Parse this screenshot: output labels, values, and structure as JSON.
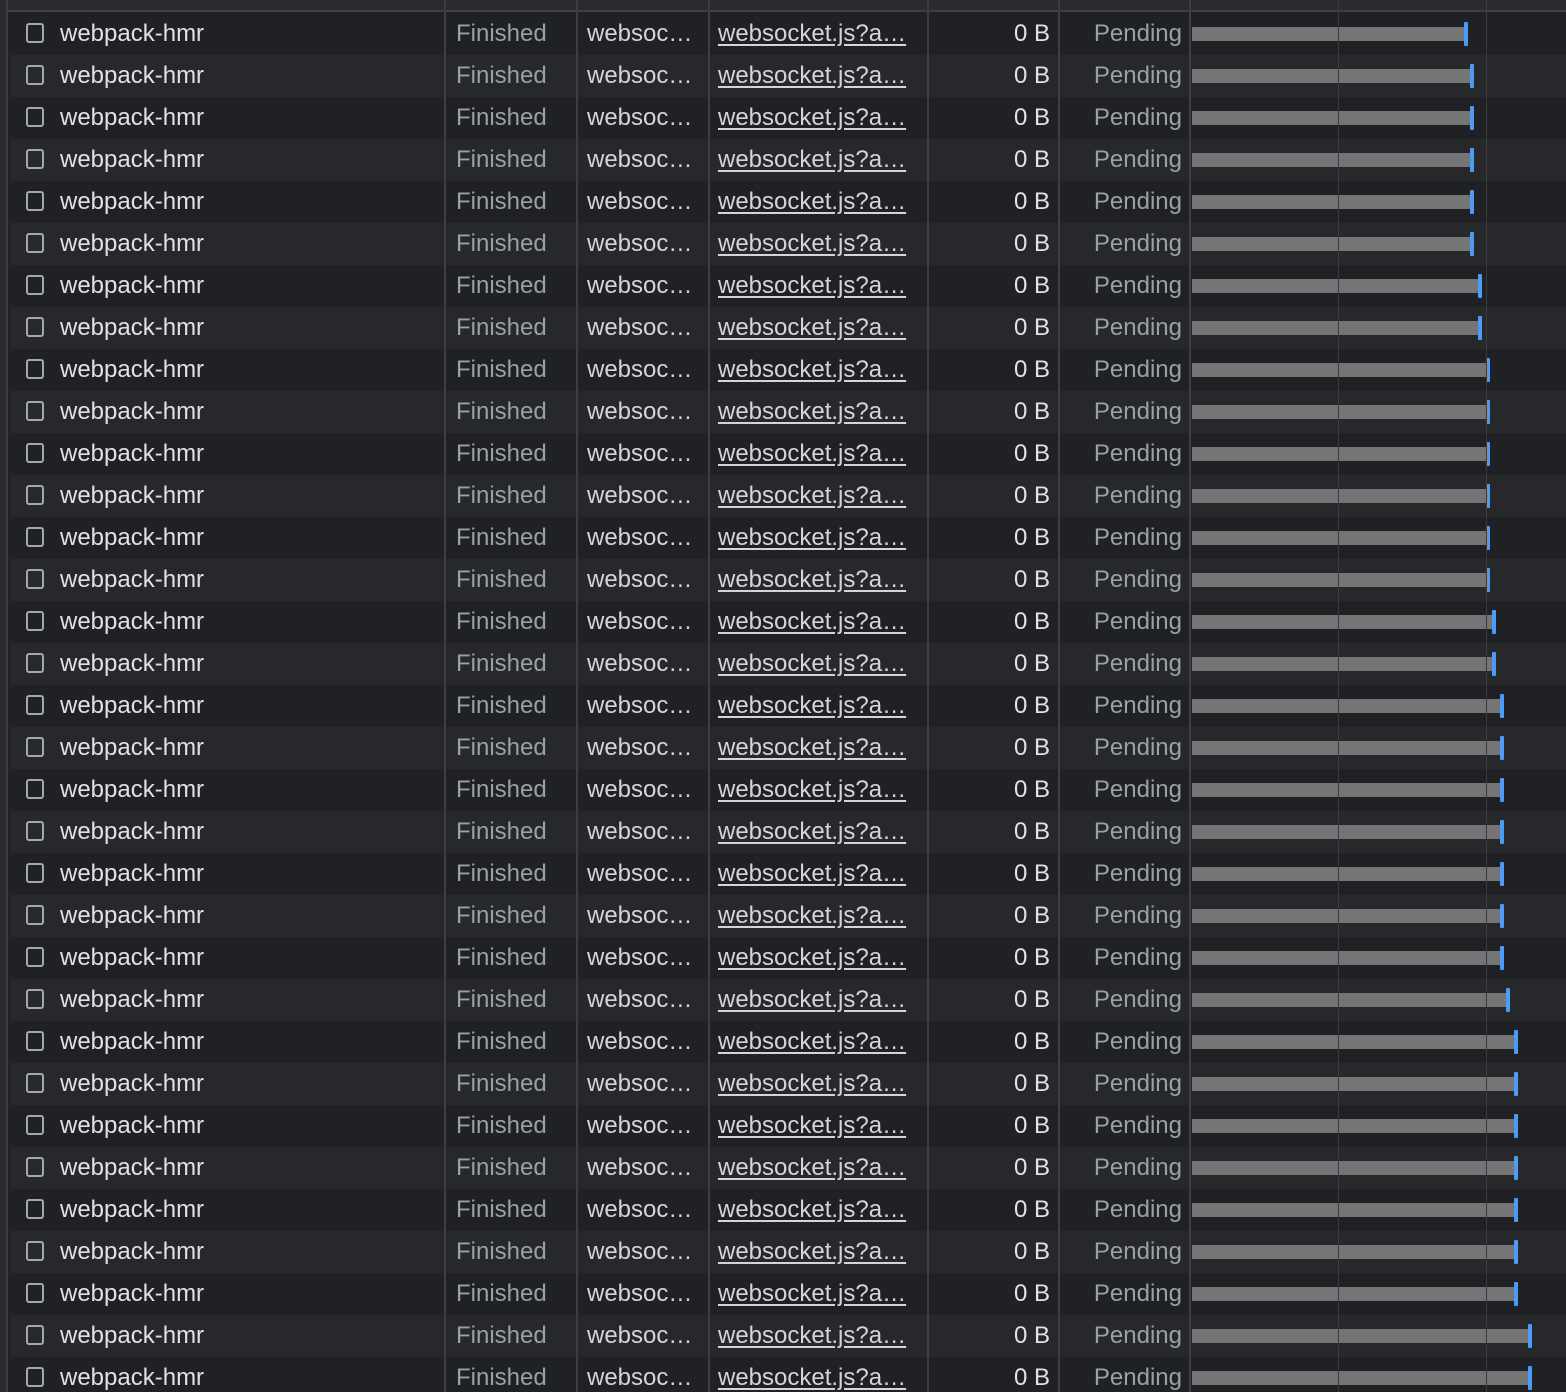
{
  "network_table": {
    "rows": [
      {
        "name": "webpack-hmr",
        "status": "Finished",
        "type": "websoc…",
        "initiator": "websocket.js?a…",
        "size": "0 B",
        "time": "Pending"
      },
      {
        "name": "webpack-hmr",
        "status": "Finished",
        "type": "websoc…",
        "initiator": "websocket.js?a…",
        "size": "0 B",
        "time": "Pending"
      },
      {
        "name": "webpack-hmr",
        "status": "Finished",
        "type": "websoc…",
        "initiator": "websocket.js?a…",
        "size": "0 B",
        "time": "Pending"
      },
      {
        "name": "webpack-hmr",
        "status": "Finished",
        "type": "websoc…",
        "initiator": "websocket.js?a…",
        "size": "0 B",
        "time": "Pending"
      },
      {
        "name": "webpack-hmr",
        "status": "Finished",
        "type": "websoc…",
        "initiator": "websocket.js?a…",
        "size": "0 B",
        "time": "Pending"
      },
      {
        "name": "webpack-hmr",
        "status": "Finished",
        "type": "websoc…",
        "initiator": "websocket.js?a…",
        "size": "0 B",
        "time": "Pending"
      },
      {
        "name": "webpack-hmr",
        "status": "Finished",
        "type": "websoc…",
        "initiator": "websocket.js?a…",
        "size": "0 B",
        "time": "Pending"
      },
      {
        "name": "webpack-hmr",
        "status": "Finished",
        "type": "websoc…",
        "initiator": "websocket.js?a…",
        "size": "0 B",
        "time": "Pending"
      },
      {
        "name": "webpack-hmr",
        "status": "Finished",
        "type": "websoc…",
        "initiator": "websocket.js?a…",
        "size": "0 B",
        "time": "Pending"
      },
      {
        "name": "webpack-hmr",
        "status": "Finished",
        "type": "websoc…",
        "initiator": "websocket.js?a…",
        "size": "0 B",
        "time": "Pending"
      },
      {
        "name": "webpack-hmr",
        "status": "Finished",
        "type": "websoc…",
        "initiator": "websocket.js?a…",
        "size": "0 B",
        "time": "Pending"
      },
      {
        "name": "webpack-hmr",
        "status": "Finished",
        "type": "websoc…",
        "initiator": "websocket.js?a…",
        "size": "0 B",
        "time": "Pending"
      },
      {
        "name": "webpack-hmr",
        "status": "Finished",
        "type": "websoc…",
        "initiator": "websocket.js?a…",
        "size": "0 B",
        "time": "Pending"
      },
      {
        "name": "webpack-hmr",
        "status": "Finished",
        "type": "websoc…",
        "initiator": "websocket.js?a…",
        "size": "0 B",
        "time": "Pending"
      },
      {
        "name": "webpack-hmr",
        "status": "Finished",
        "type": "websoc…",
        "initiator": "websocket.js?a…",
        "size": "0 B",
        "time": "Pending"
      },
      {
        "name": "webpack-hmr",
        "status": "Finished",
        "type": "websoc…",
        "initiator": "websocket.js?a…",
        "size": "0 B",
        "time": "Pending"
      },
      {
        "name": "webpack-hmr",
        "status": "Finished",
        "type": "websoc…",
        "initiator": "websocket.js?a…",
        "size": "0 B",
        "time": "Pending"
      },
      {
        "name": "webpack-hmr",
        "status": "Finished",
        "type": "websoc…",
        "initiator": "websocket.js?a…",
        "size": "0 B",
        "time": "Pending"
      },
      {
        "name": "webpack-hmr",
        "status": "Finished",
        "type": "websoc…",
        "initiator": "websocket.js?a…",
        "size": "0 B",
        "time": "Pending"
      },
      {
        "name": "webpack-hmr",
        "status": "Finished",
        "type": "websoc…",
        "initiator": "websocket.js?a…",
        "size": "0 B",
        "time": "Pending"
      },
      {
        "name": "webpack-hmr",
        "status": "Finished",
        "type": "websoc…",
        "initiator": "websocket.js?a…",
        "size": "0 B",
        "time": "Pending"
      },
      {
        "name": "webpack-hmr",
        "status": "Finished",
        "type": "websoc…",
        "initiator": "websocket.js?a…",
        "size": "0 B",
        "time": "Pending"
      },
      {
        "name": "webpack-hmr",
        "status": "Finished",
        "type": "websoc…",
        "initiator": "websocket.js?a…",
        "size": "0 B",
        "time": "Pending"
      },
      {
        "name": "webpack-hmr",
        "status": "Finished",
        "type": "websoc…",
        "initiator": "websocket.js?a…",
        "size": "0 B",
        "time": "Pending"
      },
      {
        "name": "webpack-hmr",
        "status": "Finished",
        "type": "websoc…",
        "initiator": "websocket.js?a…",
        "size": "0 B",
        "time": "Pending"
      },
      {
        "name": "webpack-hmr",
        "status": "Finished",
        "type": "websoc…",
        "initiator": "websocket.js?a…",
        "size": "0 B",
        "time": "Pending"
      },
      {
        "name": "webpack-hmr",
        "status": "Finished",
        "type": "websoc…",
        "initiator": "websocket.js?a…",
        "size": "0 B",
        "time": "Pending"
      },
      {
        "name": "webpack-hmr",
        "status": "Finished",
        "type": "websoc…",
        "initiator": "websocket.js?a…",
        "size": "0 B",
        "time": "Pending"
      },
      {
        "name": "webpack-hmr",
        "status": "Finished",
        "type": "websoc…",
        "initiator": "websocket.js?a…",
        "size": "0 B",
        "time": "Pending"
      },
      {
        "name": "webpack-hmr",
        "status": "Finished",
        "type": "websoc…",
        "initiator": "websocket.js?a…",
        "size": "0 B",
        "time": "Pending"
      },
      {
        "name": "webpack-hmr",
        "status": "Finished",
        "type": "websoc…",
        "initiator": "websocket.js?a…",
        "size": "0 B",
        "time": "Pending"
      },
      {
        "name": "webpack-hmr",
        "status": "Finished",
        "type": "websoc…",
        "initiator": "websocket.js?a…",
        "size": "0 B",
        "time": "Pending"
      },
      {
        "name": "webpack-hmr",
        "status": "Finished",
        "type": "websoc…",
        "initiator": "websocket.js?a…",
        "size": "0 B",
        "time": "Pending"
      }
    ]
  },
  "colors": {
    "background": "#202124",
    "row_alt": "#27282b",
    "waterfall_bar": "#757575",
    "waterfall_marker": "#4b9bf7"
  },
  "icons": {
    "row_checkbox": "checkbox-icon"
  }
}
